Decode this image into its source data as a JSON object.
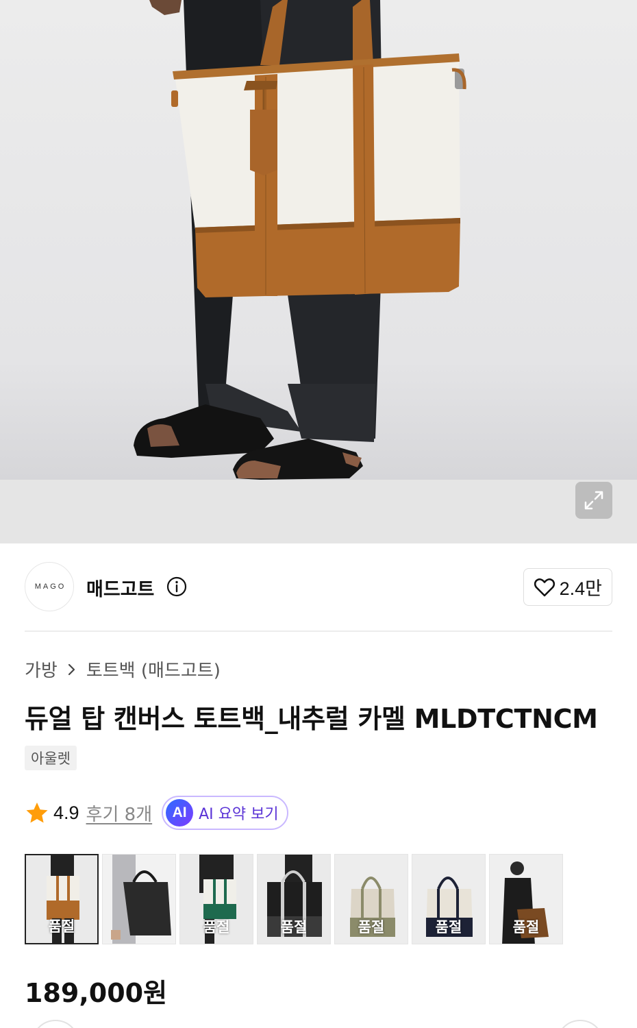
{
  "hero": {
    "expand_icon": "expand-arrows-icon"
  },
  "seller": {
    "logo_text": "MAGO",
    "brand_name": "매드고트",
    "info_icon": "info-circle-icon",
    "like_icon": "heart-outline-icon",
    "like_count": "2.4만"
  },
  "breadcrumb": {
    "category": "가방",
    "separator_icon": "chevron-right-icon",
    "subcategory": "토트백 (매드고트)"
  },
  "product": {
    "title": "듀얼 탑 캔버스 토트백_내추럴 카멜 MLDTCTNCM",
    "tag": "아울렛",
    "price": "189,000원"
  },
  "rating": {
    "star_icon": "star-filled-icon",
    "value": "4.9",
    "review_link": "후기 8개",
    "ai_badge": "AI",
    "ai_label": "AI 요약 보기"
  },
  "thumbnails": [
    {
      "label": "품절",
      "variant": "camel"
    },
    {
      "label": "",
      "variant": "black"
    },
    {
      "label": "품절",
      "variant": "green"
    },
    {
      "label": "품절",
      "variant": "black-strap"
    },
    {
      "label": "품절",
      "variant": "khaki"
    },
    {
      "label": "품절",
      "variant": "navy"
    },
    {
      "label": "품절",
      "variant": "model-brown"
    }
  ],
  "colors": {
    "accent_ai": "#5a33d6",
    "star": "#ff9d0a",
    "camel": "#b06a2a",
    "canvas": "#f2f0ea"
  }
}
